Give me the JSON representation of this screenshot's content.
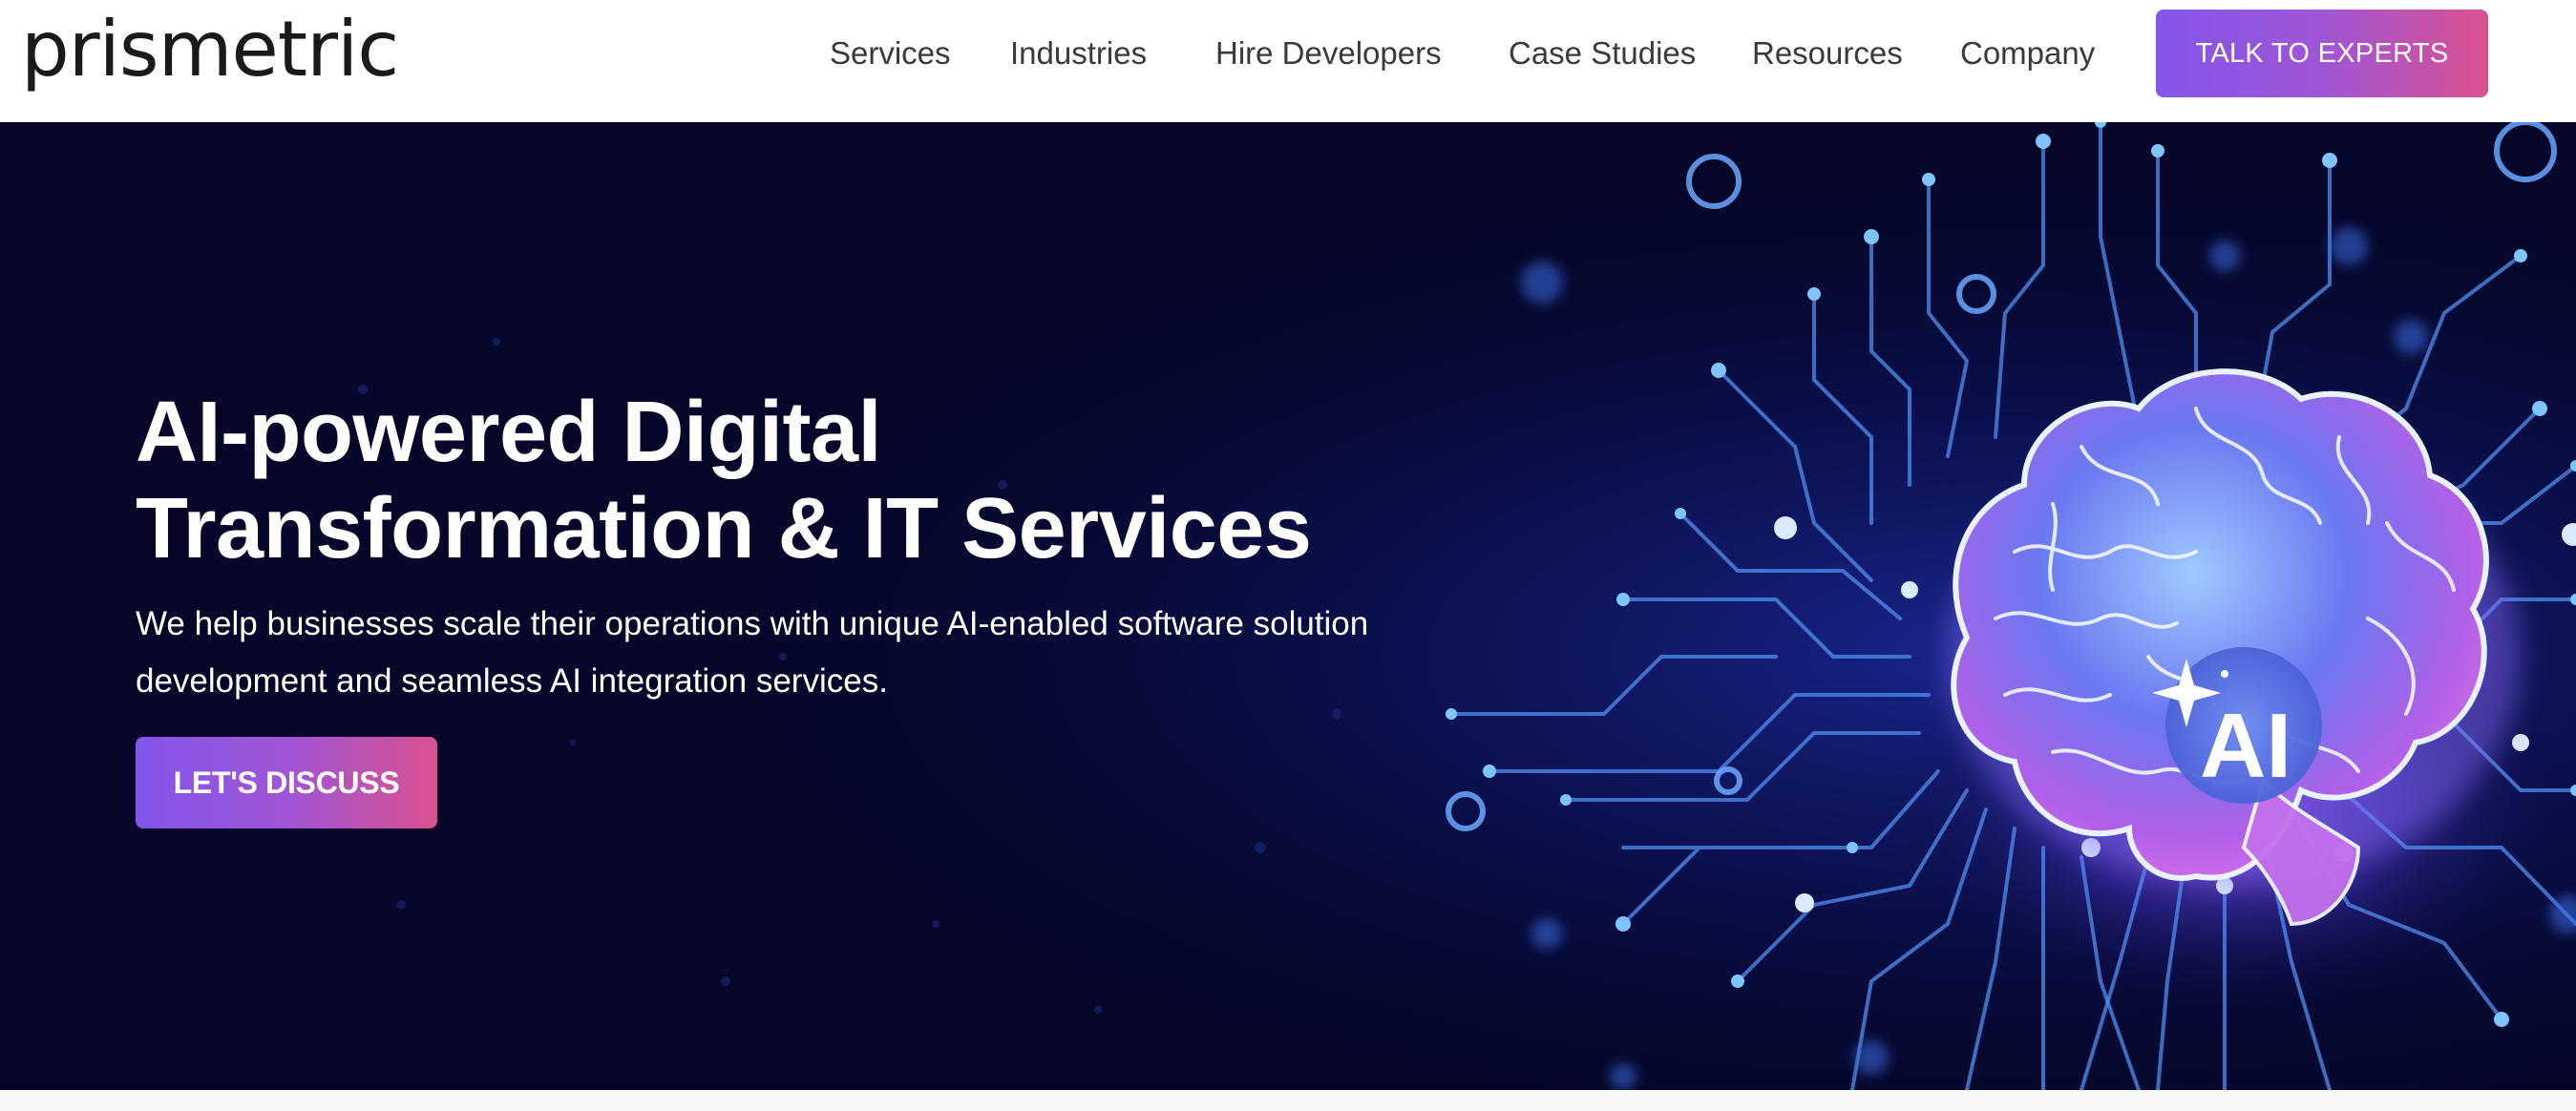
{
  "brand": {
    "logo_text": "prismetric"
  },
  "nav": {
    "items": [
      {
        "label": "Services"
      },
      {
        "label": "Industries"
      },
      {
        "label": "Hire Developers"
      },
      {
        "label": "Case Studies"
      },
      {
        "label": "Resources"
      },
      {
        "label": "Company"
      }
    ],
    "cta_label": "TALK TO EXPERTS"
  },
  "hero": {
    "title_line1": "AI-powered Digital",
    "title_line2": "Transformation & IT Services",
    "subtitle_line1": "We help businesses scale their operations with unique AI-enabled software solution",
    "subtitle_line2": "development and seamless AI integration services.",
    "cta_label": "LET'S DISCUSS",
    "badge_text": "AI"
  },
  "colors": {
    "hero_background": "#050629",
    "accent_gradient_start": "#8356ea",
    "accent_gradient_end": "#d9528f",
    "circuit_line": "#4f8ff0",
    "brain_glow": "#c86bf0"
  },
  "icons": {
    "hero_illustration": "brain-circuit-icon",
    "badge_sparkle": "sparkle-icon"
  }
}
